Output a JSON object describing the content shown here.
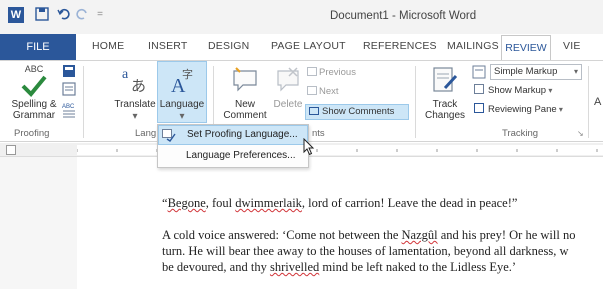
{
  "window": {
    "title": "Document1 - Microsoft Word",
    "quick_access": {
      "app_icon": "W",
      "save_icon": "save-icon",
      "undo_icon": "undo-icon",
      "redo_icon": "redo-icon",
      "customize": "="
    }
  },
  "tabs": [
    "FILE",
    "HOME",
    "INSERT",
    "DESIGN",
    "PAGE LAYOUT",
    "REFERENCES",
    "MAILINGS",
    "REVIEW",
    "VIE"
  ],
  "active_tab": "REVIEW",
  "ribbon": {
    "proofing": {
      "group_label": "Proofing",
      "spelling": {
        "icon_text": "ABC",
        "label_line1": "Spelling &",
        "label_line2": "Grammar"
      }
    },
    "language": {
      "group_label": "Lang",
      "translate": {
        "label": "Translate"
      },
      "language": {
        "label": "Language"
      },
      "caret": "▾"
    },
    "comments": {
      "group_label": "nts",
      "new_comment": {
        "line1": "New",
        "line2": "Comment"
      },
      "delete": {
        "label": "Delete"
      },
      "previous": "Previous",
      "next": "Next",
      "show_comments": "Show Comments"
    },
    "tracking": {
      "group_label": "Tracking",
      "track_changes": {
        "line1": "Track",
        "line2": "Changes"
      },
      "markup_dropdown": "Simple Markup",
      "show_markup": "Show Markup",
      "reviewing_pane": "Reviewing Pane",
      "next_group_letter": "A"
    }
  },
  "language_menu": {
    "items": [
      {
        "label": "Set Proofing Language...",
        "highlighted": true
      },
      {
        "label": "Language Preferences...",
        "highlighted": false
      }
    ]
  },
  "document": {
    "para1": {
      "q_open": "“",
      "w1": "Begone",
      "t1": ", foul ",
      "w2": "dwimmerlaik",
      "t2": ", lord of carrion! Leave the dead in peace!”"
    },
    "para2": {
      "line1": "A cold voice answered: ‘Come not between the ",
      "w1": "Nazgûl",
      "line1_tail": " and his prey! Or he will no",
      "line2": "turn. He will bear thee away to the houses of lamentation, beyond all darkness, w",
      "line3_a": "be devoured, and thy ",
      "w2": "shrivelled",
      "line3_b": " mind be left naked to the Lidless Eye.’"
    }
  },
  "colors": {
    "accent": "#2b579a",
    "menu_highlight": "#cde6f7",
    "spell_error": "#d13438"
  }
}
